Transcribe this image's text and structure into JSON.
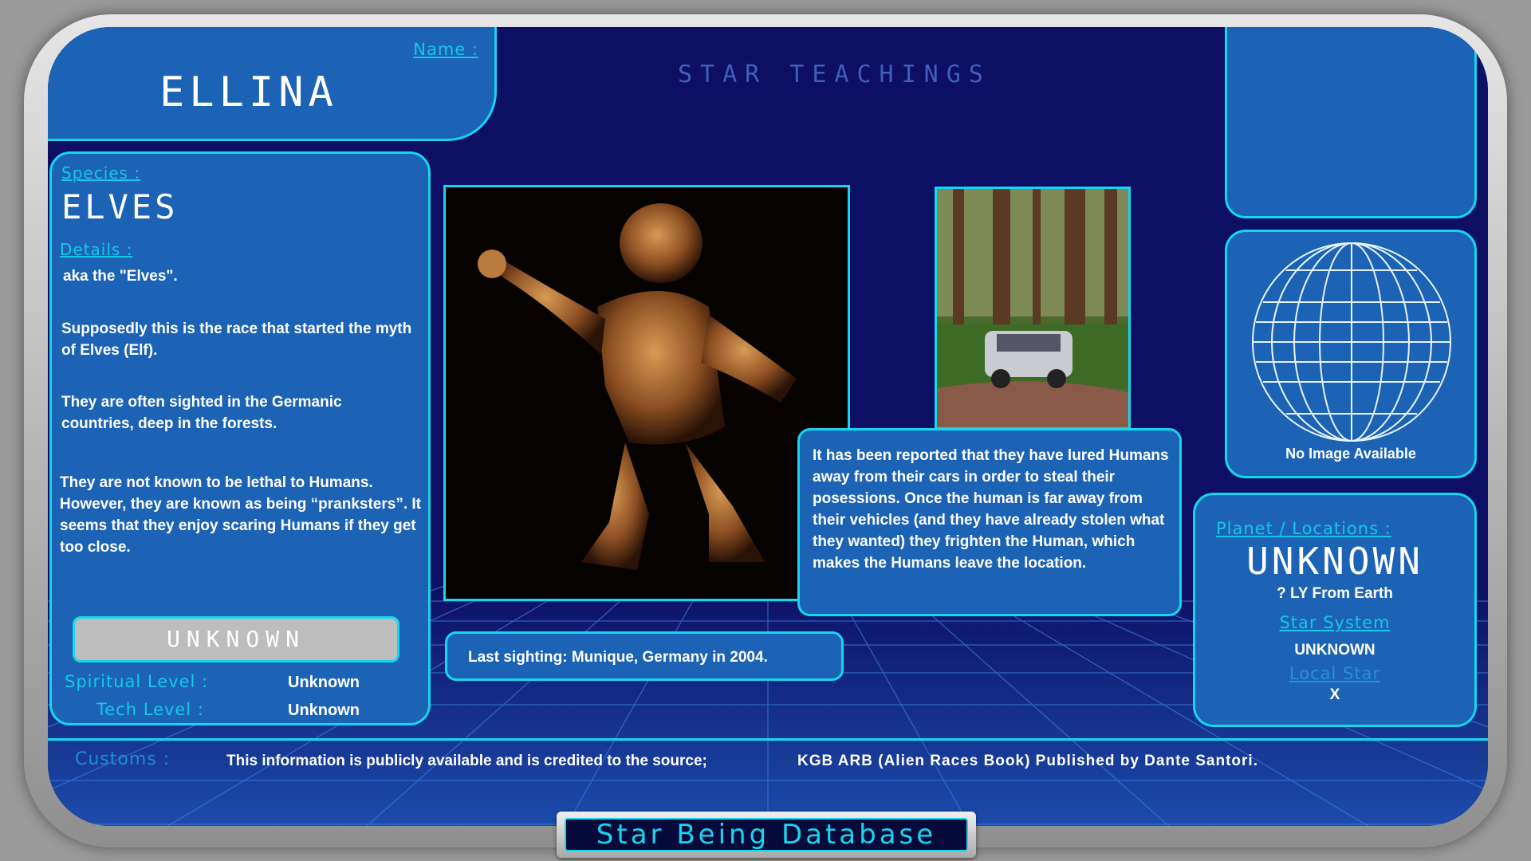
{
  "app": {
    "title": "STAR TEACHINGS",
    "footer_title": "Star Being Database"
  },
  "name": {
    "label": "Name :",
    "value": "ELLINA"
  },
  "species": {
    "label": "Species :",
    "value": "ELVES",
    "details_label": "Details :",
    "details": [
      "aka the \"Elves\".",
      "Supposedly this is the race that started the myth of Elves (Elf).",
      "They are often sighted in the Germanic countries, deep in the forests.",
      "They are not known to be lethal to Humans. However, they are known as being “pranksters”. It seems that they enjoy scaring Humans if they get too close."
    ],
    "status_button": "UNKNOWN",
    "spiritual_label": "Spiritual Level :",
    "spiritual_value": "Unknown",
    "tech_label": "Tech Level :",
    "tech_value": "Unknown"
  },
  "main": {
    "report_text": "It has been reported that they have lured Humans away from their cars in order to steal their posessions. Once the human is far away from their vehicles (and they have already stolen what they wanted) they frighten the Human, which makes the Humans leave the location.",
    "last_sighting": "Last sighting: Munique, Germany in 2004."
  },
  "right": {
    "globe_caption": "No Image Available",
    "planet_label": "Planet / Locations :",
    "planet_value": "UNKNOWN",
    "distance": "? LY From Earth",
    "star_system_label": "Star System",
    "star_system_value": "UNKNOWN",
    "local_star_label": "Local Star",
    "local_star_value": "X"
  },
  "customs": {
    "label": "Customs :",
    "text": "This information is publicly available and is credited to the source;",
    "source": "KGB ARB (Alien Races Book) Published by Dante Santori."
  },
  "colors": {
    "accent": "#16d6ee",
    "panel": "#1c63b5",
    "background": "#0c0f63"
  }
}
